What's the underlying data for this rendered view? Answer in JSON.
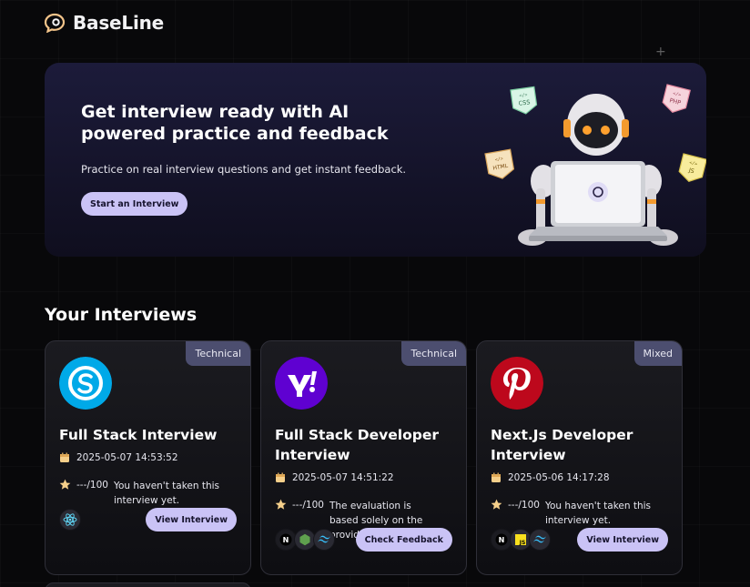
{
  "app": {
    "name": "BaseLine"
  },
  "hero": {
    "title": "Get interview ready with AI powered practice and feedback",
    "subtitle": "Practice on real interview questions and get instant feedback.",
    "cta_label": "Start an Interview",
    "badges": [
      "CSS",
      "PHP",
      "HTML",
      "JS"
    ]
  },
  "section": {
    "title": "Your Interviews"
  },
  "cards": [
    {
      "tag": "Technical",
      "company_icon": "skype-logo",
      "title": "Full Stack Interview",
      "date": "2025-05-07 14:53:52",
      "score": "---/100",
      "description": "You haven't taken this interview yet.",
      "tech_icons": [
        "react-icon"
      ],
      "action_label": "View Interview"
    },
    {
      "tag": "Technical",
      "company_icon": "yahoo-logo",
      "title": "Full Stack Developer Interview",
      "date": "2025-05-07 14:51:22",
      "score": "---/100",
      "description": "The evaluation is based solely on the provided...",
      "tech_icons": [
        "nextjs-icon",
        "nodejs-icon",
        "tailwind-icon"
      ],
      "action_label": "Check Feedback"
    },
    {
      "tag": "Mixed",
      "company_icon": "pinterest-logo",
      "title": "Next.Js Developer Interview",
      "date": "2025-05-06 14:17:28",
      "score": "---/100",
      "description": "You haven't taken this interview yet.",
      "tech_icons": [
        "nextjs-icon",
        "javascript-icon",
        "tailwind-icon"
      ],
      "action_label": "View Interview"
    }
  ],
  "colors": {
    "background": "#08080a",
    "accent": "#cac3f6",
    "tag": "#4c4e6f",
    "skype": "#00a9e8",
    "yahoo": "#5f01d1",
    "pinterest": "#bd081c"
  }
}
